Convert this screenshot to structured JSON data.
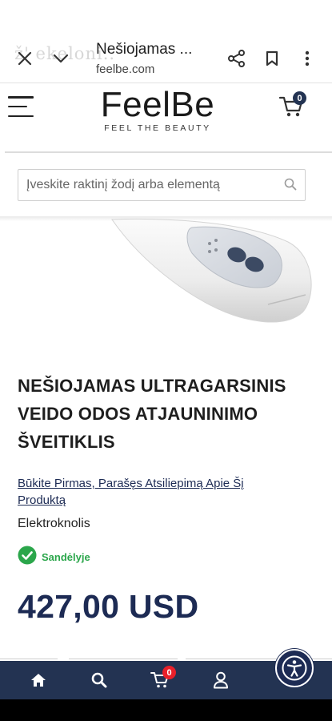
{
  "browser": {
    "title": "Nešiojamas ...",
    "url": "feelbe.com",
    "ghost_text": "ž' ekeloni.."
  },
  "header": {
    "logo_main": "FeelBe",
    "logo_tagline": "FEEL THE BEAUTY",
    "cart_count": "0"
  },
  "search": {
    "placeholder": "Įveskite raktinį žodį arba elementą"
  },
  "product": {
    "title": "NEŠIOJAMAS ULTRAGARSINIS VEIDO ODOS ATJAUNINIMO ŠVEITIKLIS",
    "review_link": "Būkite Pirmas, Parašęs Atsiliepimą Apie Šį Produktą",
    "brand": "Elektroknolis",
    "stock_status": "Sandėlyje",
    "price": "427,00 USD"
  },
  "bottom_nav": {
    "cart_count": "0",
    "items": [
      "home-icon",
      "search-icon",
      "cart-icon",
      "account-icon"
    ]
  },
  "colors": {
    "brand_navy": "#233352",
    "accent_navy": "#1d2b54",
    "stock_green": "#2ba64b",
    "badge_red": "#e8202a"
  }
}
